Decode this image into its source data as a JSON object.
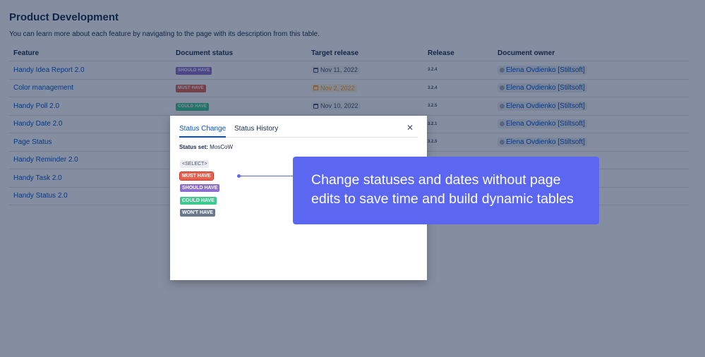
{
  "page": {
    "title": "Product Development",
    "description": "You can learn more about each feature by navigating to the page with its description from this table."
  },
  "table": {
    "headers": {
      "feature": "Feature",
      "status": "Document status",
      "target": "Target release",
      "release": "Release",
      "owner": "Document owner"
    },
    "rows": [
      {
        "feature": "Handy Idea Report 2.0",
        "status": "SHOULD HAVE",
        "status_color": "#8e6fcf",
        "target": "Nov 11, 2022",
        "target_color": "#42526e",
        "release": "3.2.4",
        "owner": "Elena Ovdienko [Stiltsoft]"
      },
      {
        "feature": "Color management",
        "status": "MUST HAVE",
        "status_color": "#e5624f",
        "target": "Nov 2, 2022",
        "target_color": "#ff991f",
        "release": "3.2.4",
        "owner": "Elena Ovdienko [Stiltsoft]"
      },
      {
        "feature": "Handy Poll 2.0",
        "status": "COULD HAVE",
        "status_color": "#3fc98e",
        "target": "Nov 10, 2022",
        "target_color": "#42526e",
        "release": "3.2.5",
        "owner": "Elena Ovdienko [Stiltsoft]"
      },
      {
        "feature": "Handy Date 2.0",
        "status": "",
        "status_color": "",
        "target": "",
        "target_color": "",
        "release": "3.2.1",
        "owner": "Elena Ovdienko [Stiltsoft]"
      },
      {
        "feature": "Page Status",
        "status": "",
        "status_color": "",
        "target": "",
        "target_color": "",
        "release": "3.2.5",
        "owner": "Elena Ovdienko [Stiltsoft]"
      },
      {
        "feature": "Handy Reminder 2.0",
        "status": "",
        "status_color": "",
        "target": "",
        "target_color": "",
        "release": "",
        "owner": ""
      },
      {
        "feature": "Handy Task 2.0",
        "status": "",
        "status_color": "",
        "target": "",
        "target_color": "",
        "release": "",
        "owner": ""
      },
      {
        "feature": "Handy Status 2.0",
        "status": "",
        "status_color": "",
        "target": "",
        "target_color": "",
        "release": "",
        "owner": ""
      }
    ]
  },
  "modal": {
    "tabs": [
      {
        "label": "Status Change",
        "active": true
      },
      {
        "label": "Status History",
        "active": false
      }
    ],
    "close_icon": "close-icon",
    "status_set_label": "Status set:",
    "status_set_value": "MosCoW",
    "options": [
      "<SELECT>",
      "MUST HAVE",
      "SHOULD HAVE",
      "COULD HAVE",
      "WON'T HAVE"
    ]
  },
  "callout": {
    "text": "Change statuses and dates without page edits to save time and build dynamic tables",
    "color": "#5b67f0"
  }
}
